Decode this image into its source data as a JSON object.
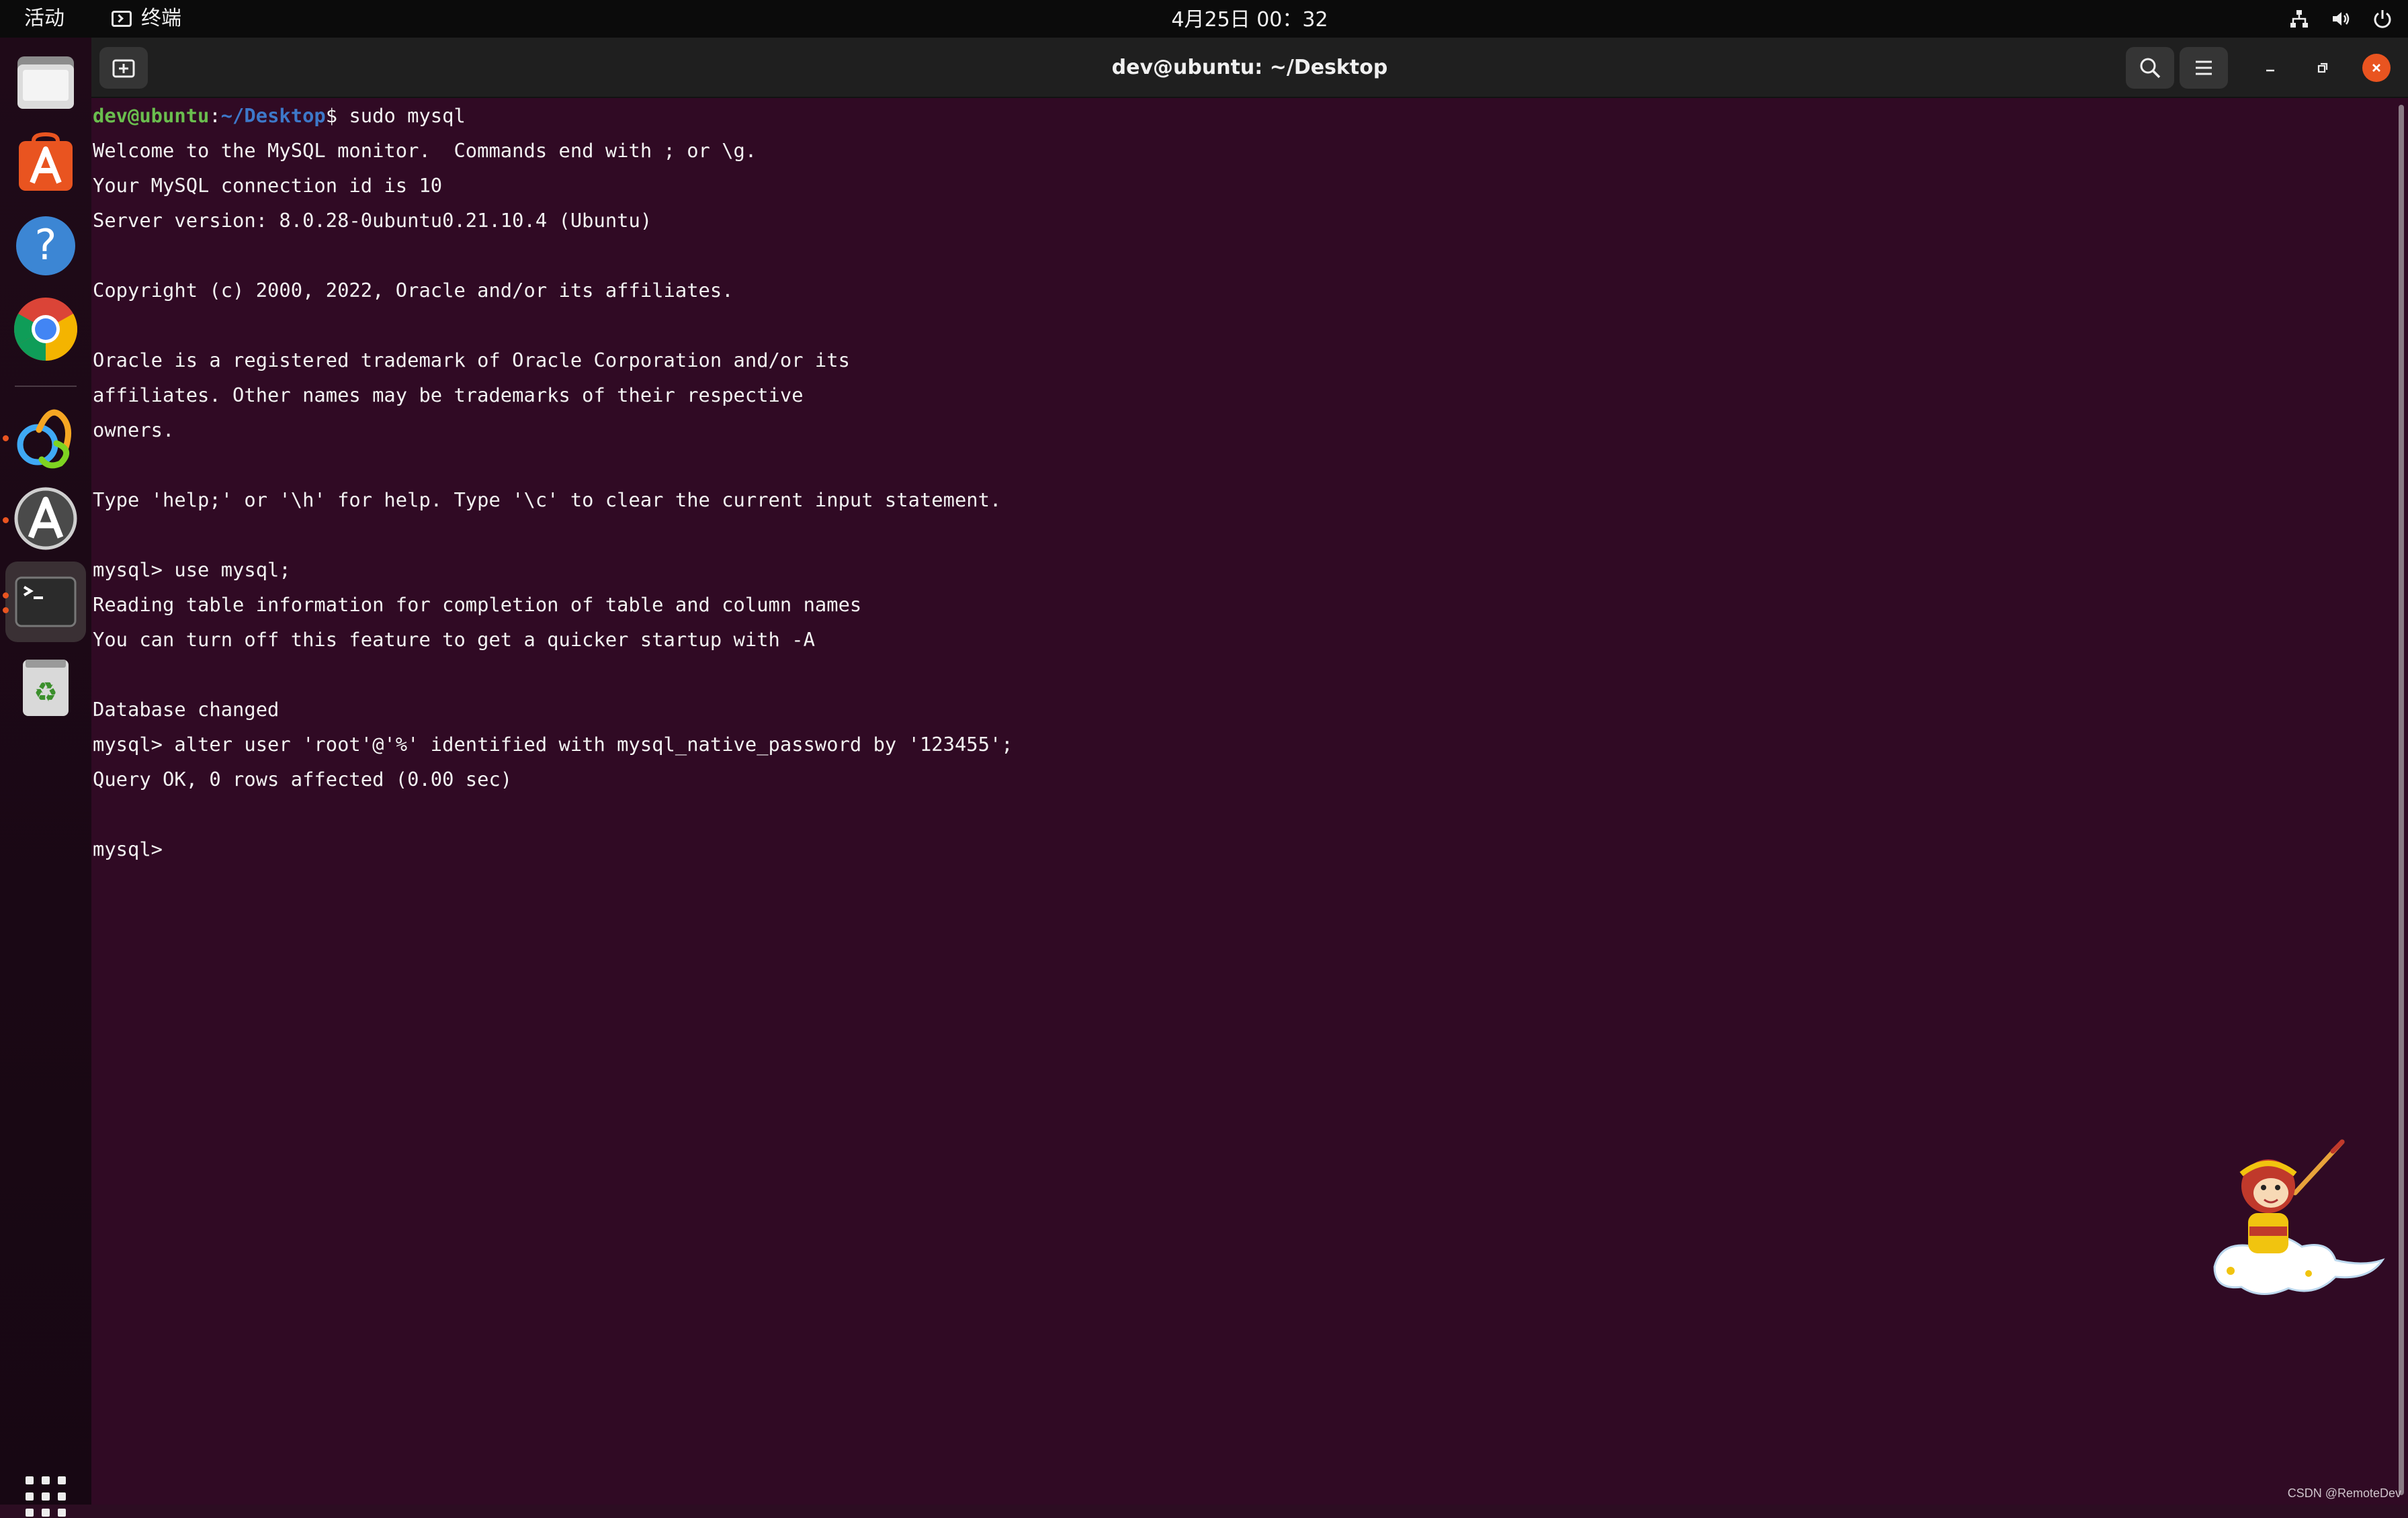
{
  "topbar": {
    "activities_label": "活动",
    "app_menu_label": "终端",
    "clock": "4月25日  00：32"
  },
  "dock": {
    "items": [
      {
        "name": "files",
        "icon": "folder-icon"
      },
      {
        "name": "ubuntu-software",
        "icon": "software-store-icon"
      },
      {
        "name": "help",
        "icon": "help-icon"
      },
      {
        "name": "google-chrome",
        "icon": "chrome-icon"
      },
      {
        "name": "navicat",
        "icon": "navicat-icon"
      },
      {
        "name": "software-updater",
        "icon": "updater-icon"
      },
      {
        "name": "terminal",
        "icon": "terminal-icon"
      },
      {
        "name": "trash",
        "icon": "trash-icon"
      }
    ],
    "running_indicator_color": "#e95420"
  },
  "window": {
    "title": "dev@ubuntu: ~/Desktop"
  },
  "terminal": {
    "prompt_user_host": "dev@ubuntu",
    "prompt_sep": ":",
    "prompt_path": "~/Desktop",
    "prompt_end": "$ sudo mysql",
    "lines": [
      "Welcome to the MySQL monitor.  Commands end with ; or \\g.",
      "Your MySQL connection id is 10",
      "Server version: 8.0.28-0ubuntu0.21.10.4 (Ubuntu)",
      "",
      "Copyright (c) 2000, 2022, Oracle and/or its affiliates.",
      "",
      "Oracle is a registered trademark of Oracle Corporation and/or its",
      "affiliates. Other names may be trademarks of their respective",
      "owners.",
      "",
      "Type 'help;' or '\\h' for help. Type '\\c' to clear the current input statement.",
      "",
      "mysql> use mysql;",
      "Reading table information for completion of table and column names",
      "You can turn off this feature to get a quicker startup with -A",
      "",
      "Database changed",
      "mysql> alter user 'root'@'%' identified with mysql_native_password by '123455';",
      "Query OK, 0 rows affected (0.00 sec)",
      "",
      "mysql> "
    ],
    "colors": {
      "background": "#300a24",
      "foreground": "#f2f2f2",
      "user": "#6abe4e",
      "path": "#3d78c9"
    }
  },
  "watermark": "CSDN @RemoteDev"
}
